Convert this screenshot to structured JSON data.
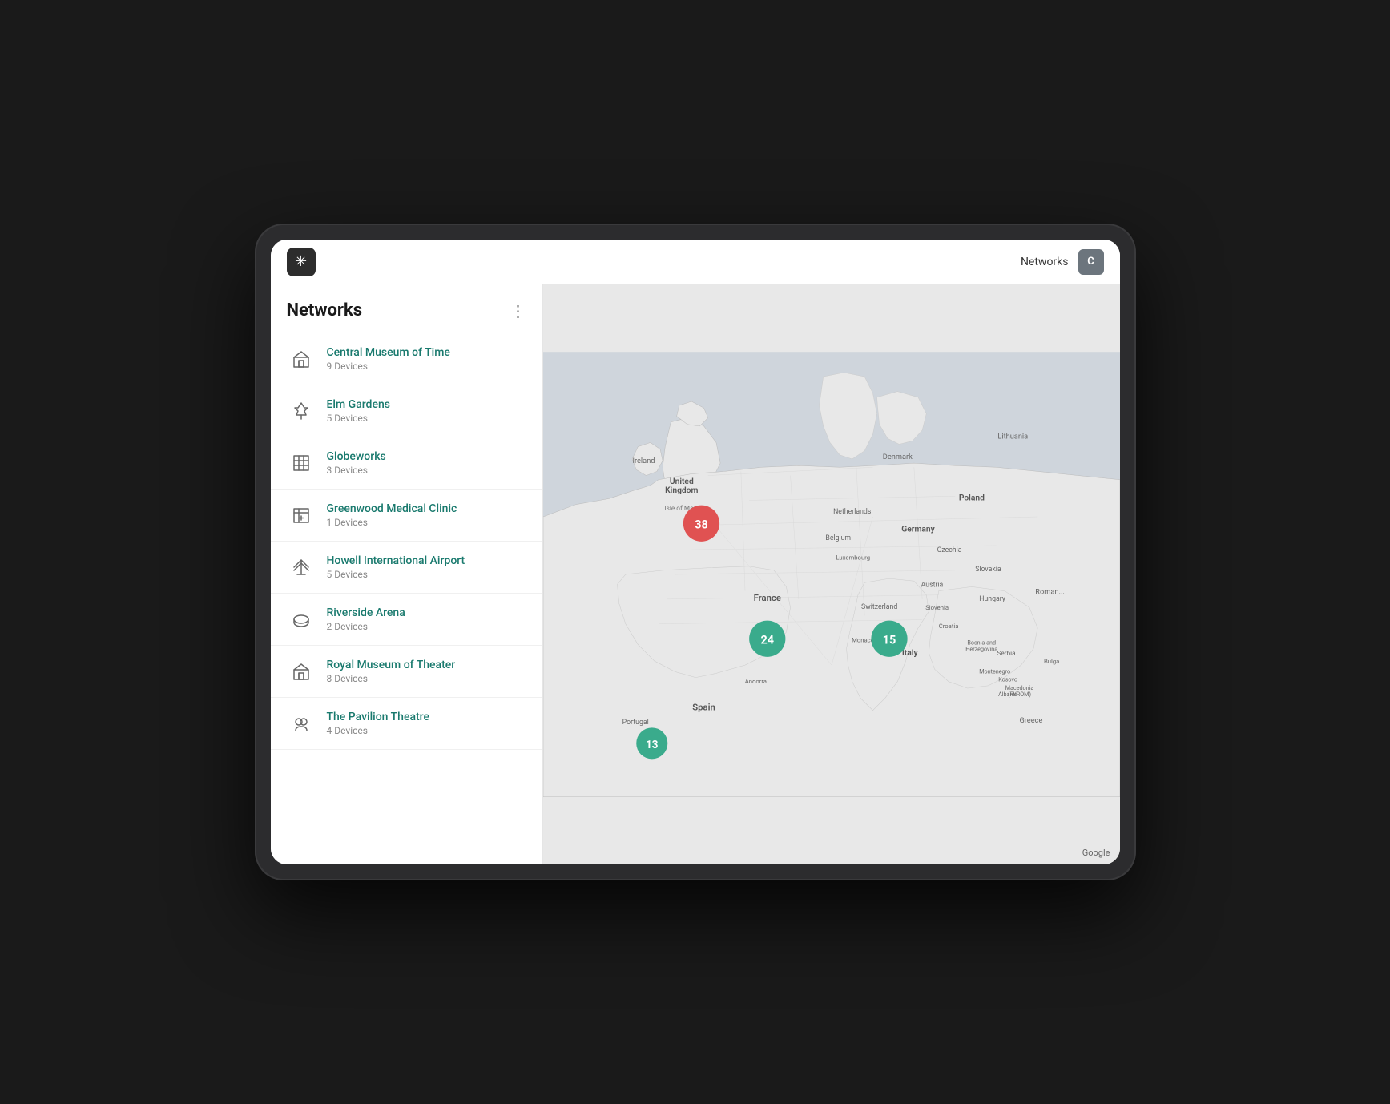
{
  "header": {
    "logo_symbol": "✳",
    "title": "Networks",
    "avatar_label": "C"
  },
  "sidebar": {
    "title": "Networks",
    "menu_icon": "⋮",
    "networks": [
      {
        "id": "central-museum-of-time",
        "name": "Central Museum of Time",
        "devices": "9 Devices",
        "icon": "museum"
      },
      {
        "id": "elm-gardens",
        "name": "Elm Gardens",
        "devices": "5 Devices",
        "icon": "park"
      },
      {
        "id": "globeworks",
        "name": "Globeworks",
        "devices": "3 Devices",
        "icon": "building"
      },
      {
        "id": "greenwood-medical-clinic",
        "name": "Greenwood Medical Clinic",
        "devices": "1 Devices",
        "icon": "clinic"
      },
      {
        "id": "howell-international-airport",
        "name": "Howell International Airport",
        "devices": "5 Devices",
        "icon": "airport"
      },
      {
        "id": "riverside-arena",
        "name": "Riverside Arena",
        "devices": "2 Devices",
        "icon": "arena"
      },
      {
        "id": "royal-museum-of-theater",
        "name": "Royal Museum of Theater",
        "devices": "8 Devices",
        "icon": "museum"
      },
      {
        "id": "the-pavilion-theatre",
        "name": "The Pavilion Theatre",
        "devices": "4 Devices",
        "icon": "theatre"
      }
    ]
  },
  "map": {
    "clusters": [
      {
        "id": "uk-cluster",
        "count": "38",
        "type": "red",
        "left": "182",
        "top": "190"
      },
      {
        "id": "france-cluster",
        "count": "24",
        "type": "green",
        "left": "262",
        "top": "365"
      },
      {
        "id": "italy-cluster",
        "count": "15",
        "type": "green",
        "left": "418",
        "top": "360"
      },
      {
        "id": "spain-cluster",
        "count": "13",
        "type": "green-sm",
        "left": "90",
        "top": "490"
      }
    ],
    "labels": [
      {
        "text": "United Kingdom",
        "left": "152",
        "top": "145"
      },
      {
        "text": "Ireland",
        "left": "82",
        "top": "210"
      },
      {
        "text": "Isle of Man",
        "left": "148",
        "top": "192"
      },
      {
        "text": "Denmark",
        "left": "400",
        "top": "115"
      },
      {
        "text": "Lithuania",
        "left": "610",
        "top": "100"
      },
      {
        "text": "Poland",
        "left": "540",
        "top": "195"
      },
      {
        "text": "Germany",
        "left": "455",
        "top": "228"
      },
      {
        "text": "Netherlands",
        "left": "392",
        "top": "196"
      },
      {
        "text": "Belgium",
        "left": "370",
        "top": "240"
      },
      {
        "text": "Luxembourg",
        "left": "385",
        "top": "268"
      },
      {
        "text": "Czechia",
        "left": "490",
        "top": "248"
      },
      {
        "text": "Slovakia",
        "left": "540",
        "top": "272"
      },
      {
        "text": "Austria",
        "left": "475",
        "top": "290"
      },
      {
        "text": "Switzerland",
        "left": "405",
        "top": "314"
      },
      {
        "text": "France",
        "left": "278",
        "top": "310"
      },
      {
        "text": "Monaco",
        "left": "390",
        "top": "358"
      },
      {
        "text": "Andorra",
        "left": "270",
        "top": "405"
      },
      {
        "text": "Spain",
        "left": "198",
        "top": "440"
      },
      {
        "text": "Portugal",
        "left": "88",
        "top": "455"
      },
      {
        "text": "Italy",
        "left": "448",
        "top": "375"
      },
      {
        "text": "Slovenia",
        "left": "476",
        "top": "315"
      },
      {
        "text": "Croatia",
        "left": "492",
        "top": "338"
      },
      {
        "text": "Hungary",
        "left": "540",
        "top": "302"
      },
      {
        "text": "Romania",
        "left": "608",
        "top": "296"
      },
      {
        "text": "Bosnia and Herzegovina",
        "left": "520",
        "top": "356"
      },
      {
        "text": "Serbia",
        "left": "555",
        "top": "368"
      },
      {
        "text": "Montenegro",
        "left": "540",
        "top": "392"
      },
      {
        "text": "Kosovo",
        "left": "558",
        "top": "400"
      },
      {
        "text": "Albania",
        "left": "560",
        "top": "418"
      },
      {
        "text": "Macedonia (FYRO)",
        "left": "570",
        "top": "410"
      },
      {
        "text": "Greece",
        "left": "586",
        "top": "450"
      },
      {
        "text": "Bulgaria",
        "left": "614",
        "top": "380"
      }
    ],
    "google_label": "Google"
  }
}
